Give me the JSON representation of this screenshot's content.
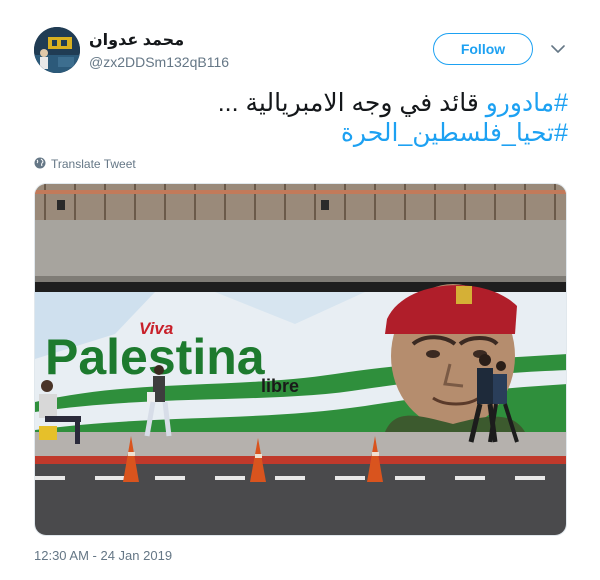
{
  "author": {
    "name": "محمد عدوان",
    "handle": "@zx2DDSm132qB116"
  },
  "actions": {
    "follow_label": "Follow",
    "caret_icon": "chevron-down-icon"
  },
  "tweet": {
    "line1_hashtag": "#مادورو",
    "line1_text": " قائد في وجه الامبريالية ...",
    "line2_hashtag": "#تحيا_فلسطين_الحرة",
    "translate_label": "Translate Tweet",
    "translate_icon": "globe-icon",
    "timestamp": "12:30 AM - 24 Jan 2019"
  },
  "media": {
    "mural_viva": "Viva",
    "mural_main": "Palestina",
    "mural_libre": "libre"
  },
  "colors": {
    "accent": "#1da1f2",
    "text": "#14171a",
    "muted": "#657786"
  }
}
